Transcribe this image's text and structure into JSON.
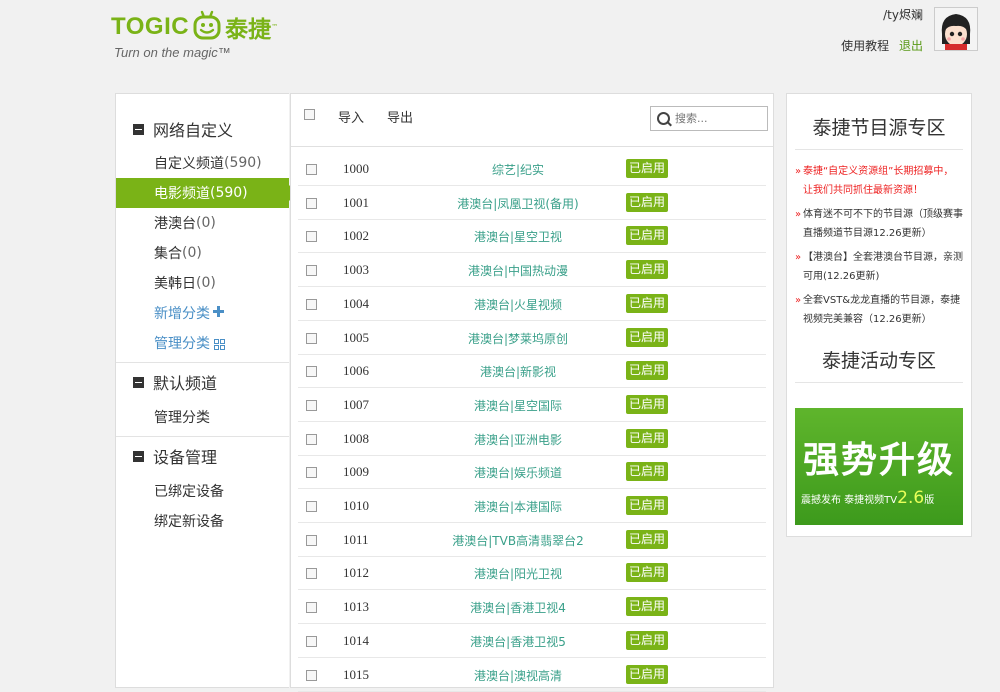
{
  "header": {
    "logo_word": "TOGIC",
    "logo_cn": "泰捷",
    "logo_tm": "™",
    "tagline": "Turn on the magic™",
    "user_name": "/ty烬斓",
    "tutorial_link": "使用教程",
    "logout_link": "退出"
  },
  "sidebar": {
    "groups": [
      {
        "title": "网络自定义",
        "items": [
          {
            "label": "自定义频道",
            "count": "(590)"
          },
          {
            "label": "电影频道",
            "count": "(590)"
          },
          {
            "label": "港澳台",
            "count": "(0)"
          },
          {
            "label": "集合",
            "count": "(0)"
          },
          {
            "label": "美韩日",
            "count": "(0)"
          },
          {
            "label": "新增分类"
          },
          {
            "label": "管理分类"
          }
        ]
      },
      {
        "title": "默认频道",
        "items": [
          {
            "label": "管理分类"
          }
        ]
      },
      {
        "title": "设备管理",
        "items": [
          {
            "label": "已绑定设备"
          },
          {
            "label": "绑定新设备"
          }
        ]
      }
    ]
  },
  "toolbar": {
    "import_label": "导入",
    "export_label": "导出",
    "search_placeholder": "搜索..."
  },
  "channels": [
    {
      "id": "1000",
      "name": "综艺|纪实",
      "status": "已启用"
    },
    {
      "id": "1001",
      "name": "港澳台|凤凰卫视(备用)",
      "status": "已启用"
    },
    {
      "id": "1002",
      "name": "港澳台|星空卫视",
      "status": "已启用"
    },
    {
      "id": "1003",
      "name": "港澳台|中国热动漫",
      "status": "已启用"
    },
    {
      "id": "1004",
      "name": "港澳台|火星视频",
      "status": "已启用"
    },
    {
      "id": "1005",
      "name": "港澳台|梦莱坞原创",
      "status": "已启用"
    },
    {
      "id": "1006",
      "name": "港澳台|新影视",
      "status": "已启用"
    },
    {
      "id": "1007",
      "name": "港澳台|星空国际",
      "status": "已启用"
    },
    {
      "id": "1008",
      "name": "港澳台|亚洲电影",
      "status": "已启用"
    },
    {
      "id": "1009",
      "name": "港澳台|娱乐频道",
      "status": "已启用"
    },
    {
      "id": "1010",
      "name": "港澳台|本港国际",
      "status": "已启用"
    },
    {
      "id": "1011",
      "name": "港澳台|TVB高清翡翠台2",
      "status": "已启用"
    },
    {
      "id": "1012",
      "name": "港澳台|阳光卫视",
      "status": "已启用"
    },
    {
      "id": "1013",
      "name": "港澳台|香港卫视4",
      "status": "已启用"
    },
    {
      "id": "1014",
      "name": "港澳台|香港卫视5",
      "status": "已启用"
    },
    {
      "id": "1015",
      "name": "港澳台|澳视高清",
      "status": "已启用"
    }
  ],
  "right": {
    "source_title": "泰捷节目源专区",
    "news": [
      "泰捷“自定义资源组”长期招募中，让我们共同抓住最新资源！",
      "体育迷不可不下的节目源（顶级赛事直播频道节目源12.26更新）",
      "【港澳台】全套港澳台节目源，亲测可用(12.26更新)",
      "全套VST&龙龙直播的节目源，泰捷视频完美兼容（12.26更新）"
    ],
    "activity_title": "泰捷活动专区",
    "promo_big": "强势升级",
    "promo_small": "震撼发布 泰捷视频TV",
    "promo_version": "2.6",
    "promo_suffix": "版"
  },
  "colors": {
    "brand_green": "#7ab317",
    "link_blue": "#4a8fc6",
    "channel_teal": "#3aa08a",
    "hot_red": "#e22222"
  }
}
